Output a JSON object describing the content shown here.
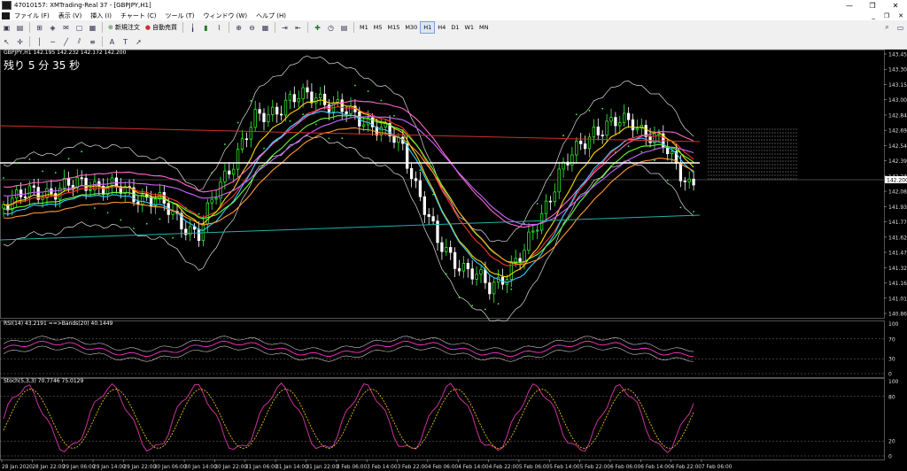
{
  "window": {
    "title": "47010157: XMTrading-Real 37 - [GBPJPY,H1]",
    "controls": [
      "—",
      "❐",
      "✕"
    ]
  },
  "menu": {
    "items": [
      "ファイル (F)",
      "表示 (V)",
      "挿入 (I)",
      "チャート (C)",
      "ツール (T)",
      "ウィンドウ (W)",
      "ヘルプ (H)"
    ],
    "mdi_controls": [
      "_",
      "❐",
      "✕"
    ]
  },
  "toolbar": {
    "new_order_label": "新規注文",
    "auto_trading_label": "自動売買",
    "periods": [
      "M1",
      "M5",
      "M15",
      "M30",
      "H1",
      "H4",
      "D1",
      "W1",
      "MN"
    ],
    "active_period": "H1"
  },
  "chart": {
    "header": "GBPJPY,H1  142.195 142.232 142.172 142.200",
    "countdown": "残り 5 分 35 秒",
    "current_price_label": "142.200",
    "price_axis": [
      "143.455",
      "143.305",
      "143.150",
      "143.000",
      "142.845",
      "142.695",
      "142.540",
      "142.390",
      "142.235",
      "142.080",
      "141.930",
      "141.775",
      "141.625",
      "141.470",
      "141.320",
      "141.165",
      "141.015",
      "140.860"
    ],
    "time_axis": [
      "28 Jan 2020",
      "28 Jan 22:00",
      "29 Jan 06:00",
      "29 Jan 14:00",
      "29 Jan 22:00",
      "30 Jan 06:00",
      "30 Jan 14:00",
      "30 Jan 22:00",
      "31 Jan 06:00",
      "31 Jan 14:00",
      "31 Jan 22:00",
      "3 Feb 06:00",
      "3 Feb 14:00",
      "3 Feb 22:00",
      "4 Feb 06:00",
      "4 Feb 14:00",
      "4 Feb 22:00",
      "5 Feb 06:00",
      "5 Feb 14:00",
      "5 Feb 22:00",
      "6 Feb 06:00",
      "6 Feb 14:00",
      "6 Feb 22:00",
      "7 Feb 06:00"
    ],
    "colors": {
      "bull": "#33ff33",
      "bear": "#ffffff",
      "background": "#000000"
    }
  },
  "rsi": {
    "header": "RSI(14) 43.2191  ==>Bands(20) 40.1449",
    "levels": [
      "70",
      "30",
      "0"
    ],
    "top": "100"
  },
  "stoch": {
    "header": "Stoch(5,3,3) 70.7746 75.0129",
    "levels": [
      "80",
      "20",
      "0"
    ],
    "top": "100"
  }
}
